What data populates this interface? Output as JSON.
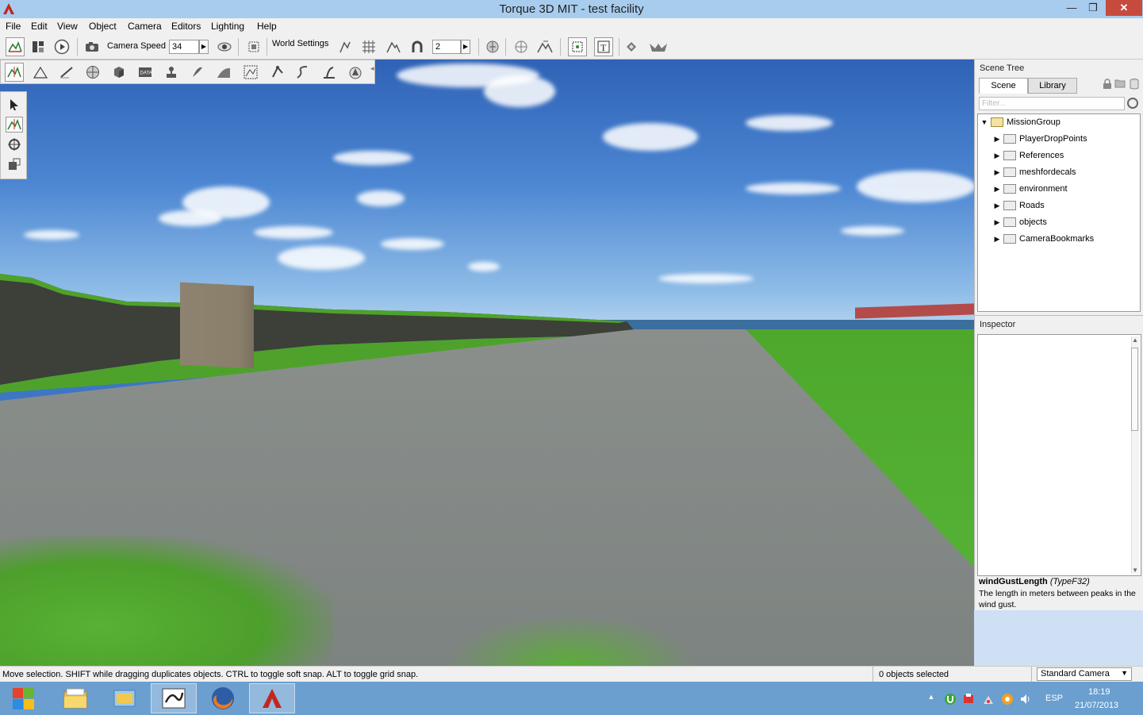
{
  "window": {
    "title": "Torque 3D MIT - test facility",
    "minimize": "—",
    "maximize": "❐",
    "close": "✕"
  },
  "menu": [
    "File",
    "Edit",
    "View",
    "Object",
    "Camera",
    "Editors",
    "Lighting",
    "Help"
  ],
  "toolbar": {
    "camera_speed_label": "Camera Speed",
    "camera_speed_value": "34",
    "world_settings_label": "World Settings",
    "snap_value": "2"
  },
  "scene_tree": {
    "header": "Scene Tree",
    "tabs": [
      "Scene",
      "Library"
    ],
    "filter_placeholder": "Filter...",
    "root": "MissionGroup",
    "items": [
      "PlayerDropPoints",
      "References",
      "meshfordecals",
      "environment",
      "Roads",
      "objects",
      "CameraBookmarks"
    ]
  },
  "inspector": {
    "header": "Inspector",
    "field_name": "windGustLength",
    "field_type": "(TypeF32)",
    "field_help": "The length in meters between peaks in the wind gust."
  },
  "status": {
    "message": "Move selection.  SHIFT while dragging duplicates objects.  CTRL to toggle soft snap.  ALT to toggle grid snap.",
    "selection_count": "0 objects selected",
    "camera_mode": "Standard Camera"
  },
  "taskbar": {
    "language": "ESP",
    "time": "18:19",
    "date": "21/07/2013"
  }
}
